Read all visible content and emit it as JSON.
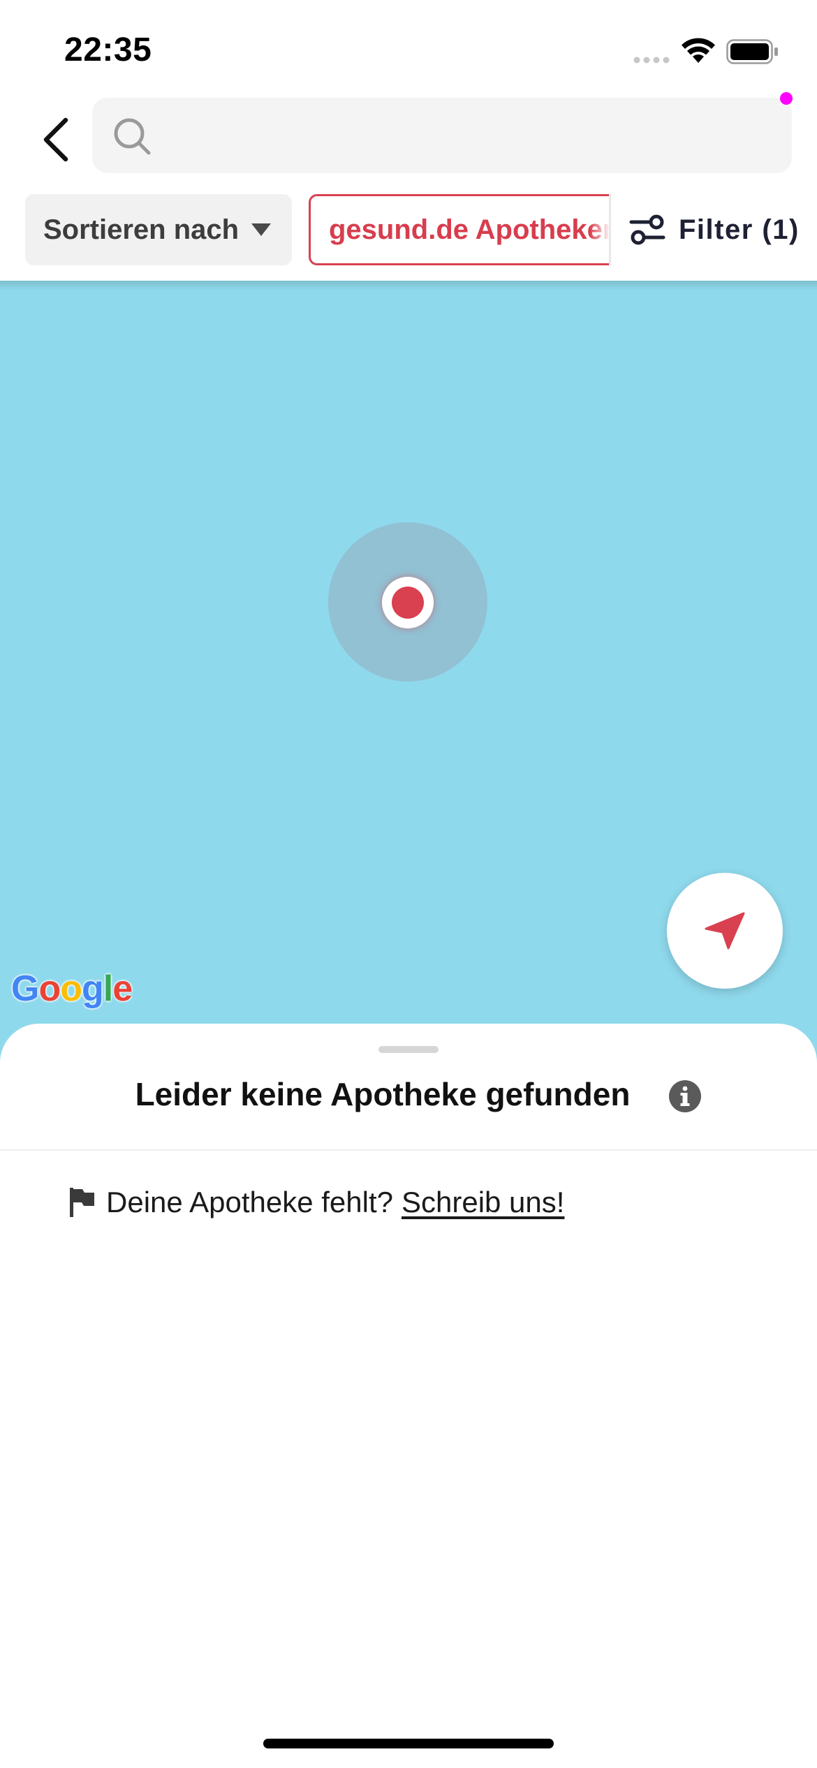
{
  "status_bar": {
    "time": "22:35",
    "icons": [
      "signal-dots-icon",
      "wifi-icon",
      "battery-icon"
    ]
  },
  "header": {
    "back_icon": "chevron-left-icon",
    "search": {
      "icon": "search-icon",
      "value": "",
      "placeholder": ""
    },
    "notification_dot_color": "#ff00ff"
  },
  "filters": {
    "sort_label": "Sortieren nach",
    "sort_icon": "caret-down-icon",
    "chip_label": "gesund.de Apotheken",
    "filter_label": "Filter (1)",
    "filter_icon": "sliders-icon"
  },
  "map": {
    "background_color": "#8fd9ec",
    "google_logo_text": "Google",
    "user_location_color": "#d94050",
    "locate_button_icon": "navigation-arrow-icon"
  },
  "sheet": {
    "title": "Leider keine Apotheke gefunden",
    "info_icon": "info-icon",
    "missing_text": "Deine Apotheke fehlt?",
    "link_text": "Schreib uns!",
    "flag_icon": "flag-icon"
  },
  "colors": {
    "accent": "#d94050",
    "text_dark": "#1e2133"
  }
}
